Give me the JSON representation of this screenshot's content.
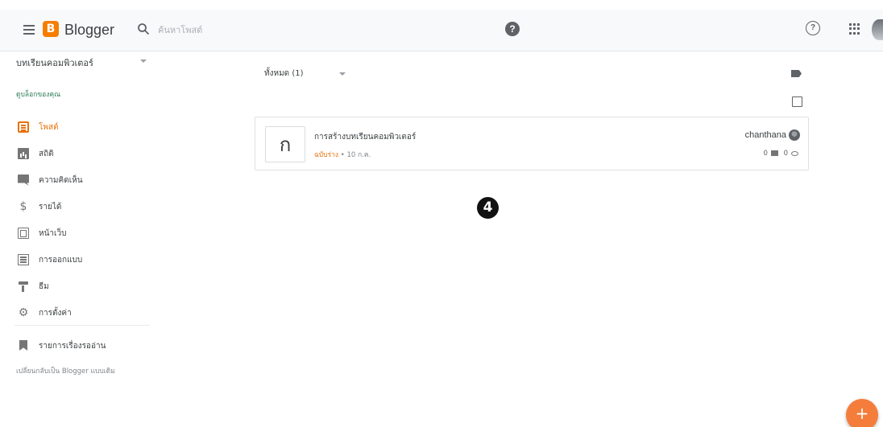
{
  "header": {
    "app_name": "Blogger",
    "logo_letter": "B",
    "search_placeholder": "ค้นหาโพสต์",
    "search_help_glyph": "?",
    "help_glyph": "?"
  },
  "sidebar": {
    "blog_name": "บทเรียนคอมพิวเตอร์",
    "view_blog": "ดูบล็อกของคุณ",
    "items": [
      {
        "label": "โพสต์",
        "icon": "posts-icon",
        "active": true
      },
      {
        "label": "สถิติ",
        "icon": "stats-icon"
      },
      {
        "label": "ความคิดเห็น",
        "icon": "comments-icon"
      },
      {
        "label": "รายได้",
        "icon": "earnings-icon",
        "glyph": "$"
      },
      {
        "label": "หน้าเว็บ",
        "icon": "pages-icon"
      },
      {
        "label": "การออกแบบ",
        "icon": "layout-icon"
      },
      {
        "label": "ธีม",
        "icon": "theme-icon"
      },
      {
        "label": "การตั้งค่า",
        "icon": "settings-icon",
        "glyph": "⚙"
      }
    ],
    "reading_list": "รายการเรื่องรออ่าน",
    "legacy_link": "เปลี่ยนกลับเป็น Blogger แบบเดิม"
  },
  "main": {
    "filter_label": "ทั้งหมด (1)",
    "posts": [
      {
        "thumb_letter": "ก",
        "title": "การสร้างบทเรียนคอมพิวเตอร์",
        "status": "ฉบับร่าง",
        "date": "• 10 ก.ค.",
        "author": "chanthana",
        "comments": "0",
        "views": "0"
      }
    ],
    "step_badge": "4",
    "fab_glyph": "+"
  },
  "colors": {
    "accent": "#e8710a",
    "fab": "#f57d3b",
    "logo": "#f57d00"
  }
}
